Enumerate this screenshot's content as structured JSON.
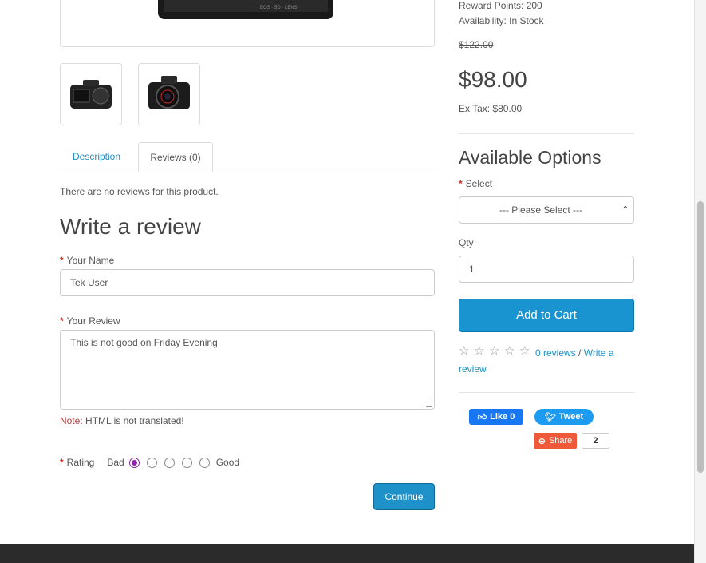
{
  "product": {
    "reward_points": "Reward Points: 200",
    "availability": "Availability: In Stock",
    "old_price": "$122.00",
    "price": "$98.00",
    "ex_tax": "Ex Tax: $80.00"
  },
  "tabs": [
    {
      "label": "Description"
    },
    {
      "label": "Reviews (0)"
    }
  ],
  "reviews": {
    "empty_text": "There are no reviews for this product.",
    "heading": "Write a review",
    "name_label": "Your Name",
    "name_value": "Tek User",
    "review_label": "Your Review",
    "review_value": "This is not good on Friday Evening",
    "note_prefix": "Note:",
    "note_text": " HTML is not translated!",
    "rating_label": "Rating",
    "bad_label": "Bad",
    "good_label": "Good",
    "selected_rating": 1,
    "continue_label": "Continue"
  },
  "options": {
    "heading": "Available Options",
    "select_label": "Select",
    "select_value": "--- Please Select ---",
    "qty_label": "Qty",
    "qty_value": "1",
    "add_to_cart": "Add to Cart"
  },
  "rating_summary": {
    "reviews_link": "0 reviews",
    "separator": " / ",
    "write_link": "Write a review"
  },
  "social": {
    "fb_like": "Like 0",
    "tweet": "Tweet",
    "share": "Share",
    "share_count": "2"
  },
  "colors": {
    "accent": "#1e91c8",
    "link": "#2390c5",
    "required": "#c9302c",
    "radio_checked": "#8e24aa"
  }
}
